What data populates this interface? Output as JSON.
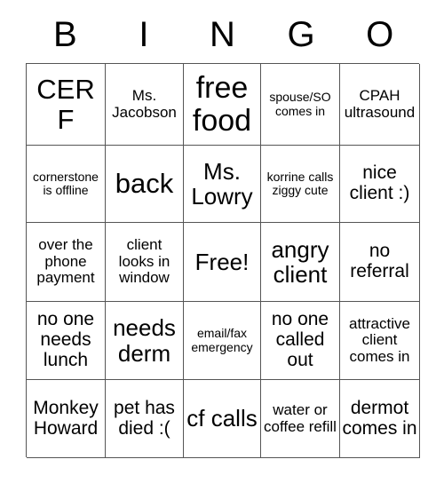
{
  "card": {
    "header_letters": [
      "B",
      "I",
      "N",
      "G",
      "O"
    ],
    "rows": [
      [
        {
          "text": "CERF",
          "size": "lg"
        },
        {
          "text": "Ms. Jacobson",
          "size": "xs"
        },
        {
          "text": "free food",
          "size": "xl"
        },
        {
          "text": "spouse/SO comes in",
          "size": "xxs"
        },
        {
          "text": "CPAH ultrasound",
          "size": "xs"
        }
      ],
      [
        {
          "text": "cornerstone is offline",
          "size": "xxs"
        },
        {
          "text": "back",
          "size": "lg"
        },
        {
          "text": "Ms. Lowry",
          "size": "md"
        },
        {
          "text": "korrine calls ziggy cute",
          "size": "xxs"
        },
        {
          "text": "nice client :)",
          "size": "sm"
        }
      ],
      [
        {
          "text": "over the phone payment",
          "size": "xs"
        },
        {
          "text": "client looks in window",
          "size": "xs"
        },
        {
          "text": "Free!",
          "size": "md"
        },
        {
          "text": "angry client",
          "size": "md"
        },
        {
          "text": "no referral",
          "size": "sm"
        }
      ],
      [
        {
          "text": "no one needs lunch",
          "size": "sm"
        },
        {
          "text": "needs derm",
          "size": "md"
        },
        {
          "text": "email/fax emergency",
          "size": "xxs"
        },
        {
          "text": "no one called out",
          "size": "sm"
        },
        {
          "text": "attractive client comes in",
          "size": "xs"
        }
      ],
      [
        {
          "text": "Monkey Howard",
          "size": "sm"
        },
        {
          "text": "pet has died :(",
          "size": "sm"
        },
        {
          "text": "cf calls",
          "size": "md"
        },
        {
          "text": "water or coffee refill",
          "size": "xs"
        },
        {
          "text": "dermot comes in",
          "size": "sm"
        }
      ]
    ]
  },
  "colors": {
    "background": "#ffffff",
    "text": "#000000",
    "border": "#555555"
  }
}
